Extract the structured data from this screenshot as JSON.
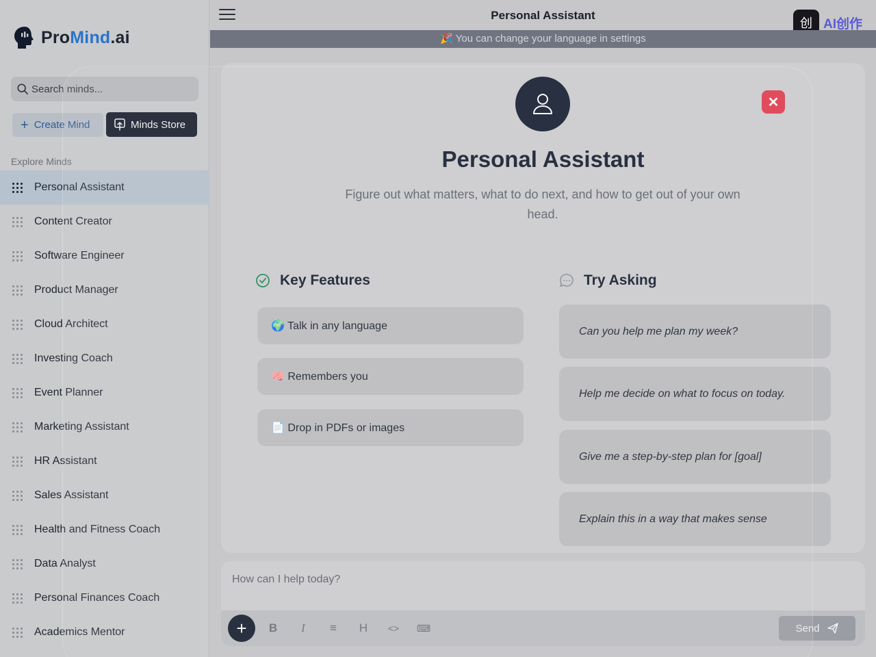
{
  "sidebar": {
    "logo": {
      "pro": "Pro",
      "mind": "Mind",
      "ai": ".ai"
    },
    "search": {
      "placeholder": "Search minds..."
    },
    "create_label": "Create Mind",
    "store_label": "Minds Store",
    "section_label": "Explore Minds",
    "items": [
      {
        "label": "Personal Assistant",
        "active": true
      },
      {
        "label": "Content Creator"
      },
      {
        "label": "Software Engineer"
      },
      {
        "label": "Product Manager"
      },
      {
        "label": "Cloud Architect"
      },
      {
        "label": "Investing Coach"
      },
      {
        "label": "Event Planner"
      },
      {
        "label": "Marketing Assistant"
      },
      {
        "label": "HR Assistant"
      },
      {
        "label": "Sales Assistant"
      },
      {
        "label": "Health and Fitness Coach"
      },
      {
        "label": "Data Analyst"
      },
      {
        "label": "Personal Finances Coach"
      },
      {
        "label": "Academics Mentor"
      }
    ]
  },
  "header": {
    "title": "Personal Assistant",
    "badge_text": "AI创作",
    "badge_icon": "创"
  },
  "banner": {
    "text": "🎉  You can change your language in settings"
  },
  "mind": {
    "title": "Personal Assistant",
    "description": "Figure out what matters, what to do next, and how to get out of your own head.",
    "features_heading": "Key Features",
    "features": [
      "🌍 Talk in any language",
      "🧠 Remembers you",
      "📄 Drop in PDFs or images"
    ],
    "asking_heading": "Try Asking",
    "prompts": [
      "Can you help me plan my week?",
      "Help me decide on what to focus on today.",
      "Give me a step-by-step plan for [goal]",
      "Explain this in a way that makes sense"
    ]
  },
  "composer": {
    "placeholder": "How can I help today?",
    "send_label": "Send",
    "format_buttons": [
      "B",
      "I",
      "≡",
      "H",
      "<>",
      "⌨"
    ]
  },
  "colors": {
    "accent_dark": "#121a2c",
    "close_red": "#e23a4a",
    "brand_blue": "#2b74c9"
  }
}
